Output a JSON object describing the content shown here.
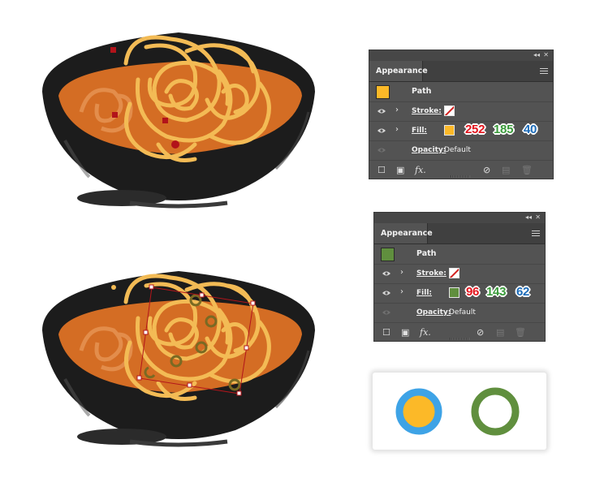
{
  "panels": [
    {
      "tab": "Appearance",
      "object": "Path",
      "swatch_color": "#fcb928",
      "stroke_label": "Stroke:",
      "fill_label": "Fill:",
      "opacity_label": "Opacity:",
      "opacity_value": "Default",
      "rgb": {
        "r": "252",
        "g": "185",
        "b": "40"
      }
    },
    {
      "tab": "Appearance",
      "object": "Path",
      "swatch_color": "#608f3e",
      "stroke_label": "Stroke:",
      "fill_label": "Fill:",
      "opacity_label": "Opacity:",
      "opacity_value": "Default",
      "rgb": {
        "r": "96",
        "g": "143",
        "b": "62"
      }
    }
  ],
  "preview": {
    "yellow_fill": "#fcb928",
    "yellow_ring": "#3ea3e6",
    "green_ring": "#608f3e"
  },
  "colors": {
    "bowl": "#1c1c1c",
    "soup": "#d46d24",
    "noodle": "#f3bb55",
    "pepper": "#b2131a",
    "selection": "#b3151b"
  },
  "icons": [
    "eye-icon",
    "chevron-right-icon",
    "menu-icon",
    "new-stroke-icon",
    "new-fill-icon",
    "fx-icon",
    "clear-icon",
    "duplicate-icon",
    "trash-icon",
    "collapse-icon",
    "close-icon"
  ]
}
